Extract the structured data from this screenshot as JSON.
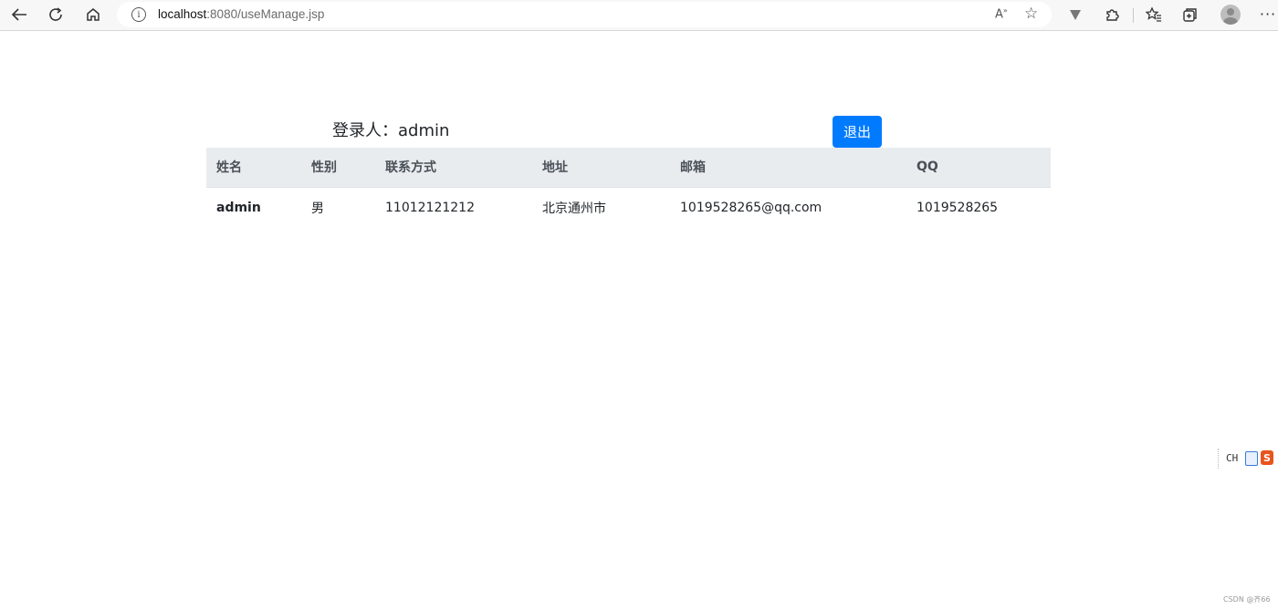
{
  "browser": {
    "url_host": "localhost",
    "url_rest": ":8080/useManage.jsp",
    "icons": {
      "back": "back-arrow-icon",
      "reload": "reload-icon",
      "home": "home-icon",
      "info": "site-info-icon",
      "read_aloud": "read-aloud-icon",
      "favorite": "add-favorite-icon",
      "extension1": "shield-extension-icon",
      "extension2": "puzzle-extension-icon",
      "favorites": "favorites-icon",
      "collections": "collections-icon",
      "profile": "profile-avatar-icon",
      "menu": "more-menu-icon"
    }
  },
  "page": {
    "login_label": "登录人：admin",
    "logout_label": "退出",
    "accent_color": "#007bff",
    "table": {
      "headers": [
        "姓名",
        "性别",
        "联系方式",
        "地址",
        "邮箱",
        "QQ"
      ],
      "rows": [
        [
          "admin",
          "男",
          "11012121212",
          "北京通州市",
          "1019528265@qq.com",
          "1019528265"
        ]
      ]
    }
  },
  "ime": {
    "label": "CH",
    "badge": "S"
  },
  "watermark": "CSDN @齐66"
}
